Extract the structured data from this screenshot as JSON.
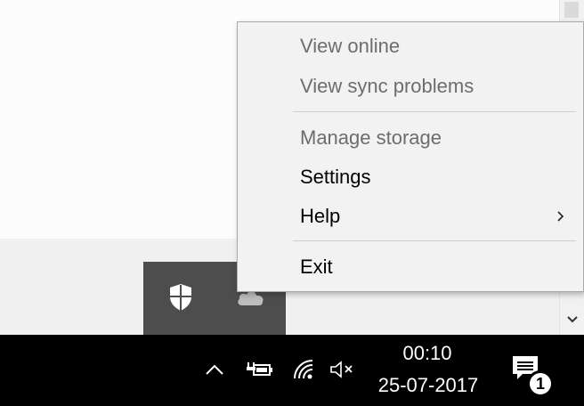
{
  "menu": {
    "items": [
      {
        "label": "View online",
        "enabled": false
      },
      {
        "label": "View sync problems",
        "enabled": false
      },
      {
        "label": "Manage storage",
        "enabled": false
      },
      {
        "label": "Settings",
        "enabled": true
      },
      {
        "label": "Help",
        "enabled": true,
        "has_submenu": true
      },
      {
        "label": "Exit",
        "enabled": true
      }
    ]
  },
  "tray_flyout": {
    "icons": [
      "windows-defender-shield-icon",
      "onedrive-cloud-icon"
    ]
  },
  "taskbar": {
    "icons": [
      "show-hidden-icons-chevron-icon",
      "battery-charging-icon",
      "wifi-icon",
      "volume-muted-icon",
      "action-center-icon"
    ],
    "clock": {
      "time": "00:10",
      "date": "25-07-2017"
    },
    "notification_count": "1"
  },
  "colors": {
    "taskbar": "#000000",
    "menu_background": "#f2f2f2",
    "menu_disabled_text": "#6d6d6d",
    "tray_flyout": "#4d4d4d"
  }
}
